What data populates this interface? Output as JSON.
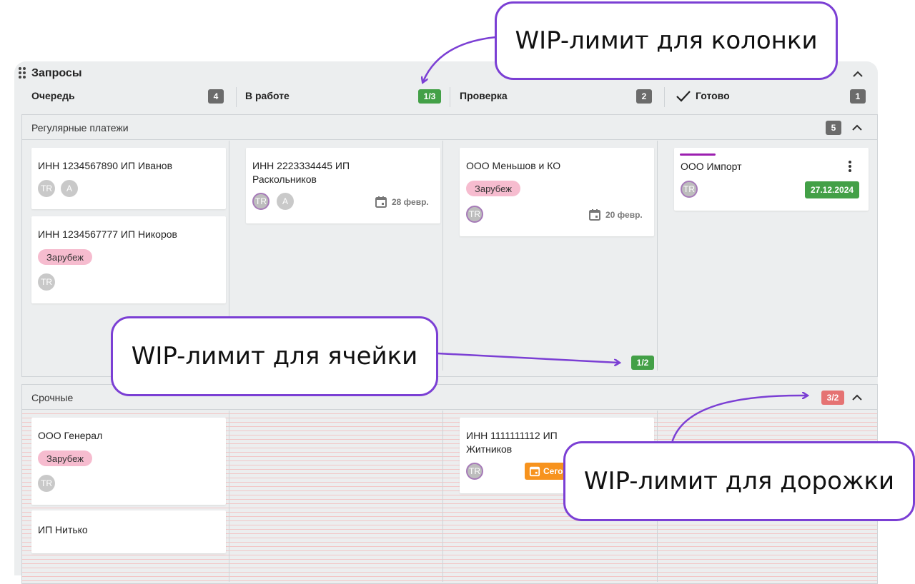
{
  "board": {
    "title": "Запросы",
    "columns": [
      {
        "label": "Очередь",
        "count": "4"
      },
      {
        "label": "В работе",
        "count": "1/3"
      },
      {
        "label": "Проверка",
        "count": "2"
      },
      {
        "label": "Готово",
        "count": "1"
      }
    ]
  },
  "lanes": [
    {
      "title": "Регулярные платежи",
      "count": "5",
      "cell_wip": "1/2",
      "cards": {
        "c1": {
          "title": "ИНН 1234567890 ИП Иванов",
          "avatars": [
            "TR",
            "A"
          ]
        },
        "c2": {
          "title": "ИНН 1234567777 ИП Никоров",
          "tag": "Зарубеж",
          "avatars": [
            "TR"
          ]
        },
        "c3": {
          "title_line1": "ИНН 2223334445 ИП",
          "title_line2": "Раскольников",
          "avatars": [
            "TR",
            "A"
          ],
          "due": "28 февр."
        },
        "c4": {
          "title": "ООО Меньшов и КО",
          "tag": "Зарубеж",
          "avatars": [
            "TR"
          ],
          "due": "20 февр."
        },
        "c5": {
          "title": "ООО Импорт",
          "avatars": [
            "TR"
          ],
          "date": "27.12.2024"
        }
      }
    },
    {
      "title": "Срочные",
      "count": "3/2",
      "cards": {
        "c1": {
          "title": "ООО Генерал",
          "tag": "Зарубеж",
          "avatars": [
            "TR"
          ]
        },
        "c2": {
          "title": "ИП Нитько"
        },
        "c3": {
          "title_line1": "ИНН 1111111112 ИП",
          "title_line2": "Житников",
          "avatars": [
            "TR"
          ],
          "due": "Сего"
        }
      }
    }
  ],
  "callouts": {
    "column": "WIP-лимит для колонки",
    "cell": "WIP-лимит для ячейки",
    "lane": "WIP-лимит для дорожки"
  },
  "colors": {
    "accent": "#7b3fd4",
    "wip_ok": "#43a047",
    "wip_over": "#e57373",
    "tag": "#f6bccf",
    "due_today": "#f7931e"
  }
}
